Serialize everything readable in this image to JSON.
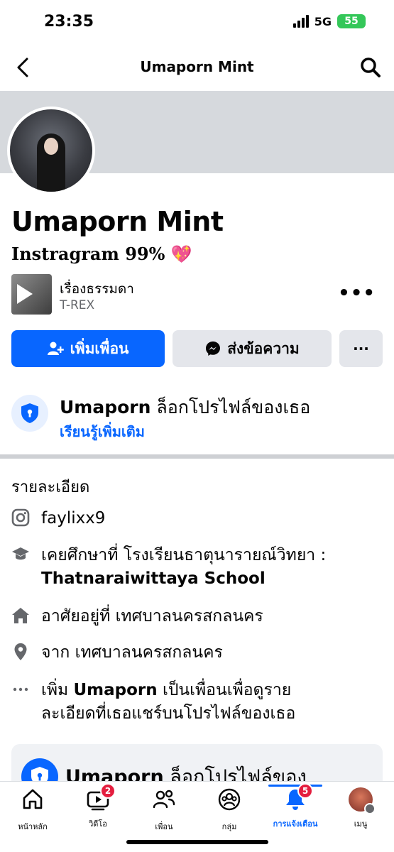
{
  "status_bar": {
    "time": "23:35",
    "network": "5G",
    "battery": "55"
  },
  "nav": {
    "title": "Umaporn Mint"
  },
  "profile": {
    "name": "Umaporn Mint",
    "bio": "Instragram 99%",
    "bio_emoji": "💖"
  },
  "music": {
    "title": "เรื่องธรรมดา",
    "artist": "T-REX",
    "more": "•••"
  },
  "actions": {
    "add_friend": "เพิ่มเพื่อน",
    "message": "ส่งข้อความ",
    "more": "···"
  },
  "locked": {
    "name": "Umaporn",
    "text": " ล็อกโปรไฟล์ของเธอ",
    "learn_more": "เรียนรู้เพิ่มเติม"
  },
  "details": {
    "title": "รายละเอียด",
    "instagram": "faylixx9",
    "education_prefix": "เคยศึกษาที่ โรงเรียนธาตุนารายณ์วิทยา :",
    "education_school": "Thatnaraiwittaya School",
    "lives_in": "อาศัยอยู่ที่ เทศบาลนครสกลนคร",
    "from": "จาก เทศบาลนครสกลนคร",
    "add_friend_prefix": "เพิ่ม ",
    "add_friend_name": "Umaporn",
    "add_friend_suffix": " เป็นเพื่อนเพื่อดูราย",
    "add_friend_line2": "ละเอียดที่เธอแชร์บนโปรไฟล์ของเธอ"
  },
  "locked_card": {
    "name": "Umaporn",
    "text": " ล็อกโปรไฟล์ของ"
  },
  "tabs": [
    {
      "label": "หน้าหลัก",
      "icon": "home-icon",
      "badge": ""
    },
    {
      "label": "วิดีโอ",
      "icon": "video-icon",
      "badge": "2"
    },
    {
      "label": "เพื่อน",
      "icon": "friends-icon",
      "badge": ""
    },
    {
      "label": "กลุ่ม",
      "icon": "groups-icon",
      "badge": ""
    },
    {
      "label": "การแจ้งเตือน",
      "icon": "bell-icon",
      "badge": "5"
    },
    {
      "label": "เมนู",
      "icon": "menu-avatar",
      "badge": ""
    }
  ],
  "colors": {
    "accent": "#0866ff",
    "badge": "#e41e3f",
    "secondary_button": "#e4e6eb",
    "cover": "#d6d9dd"
  }
}
